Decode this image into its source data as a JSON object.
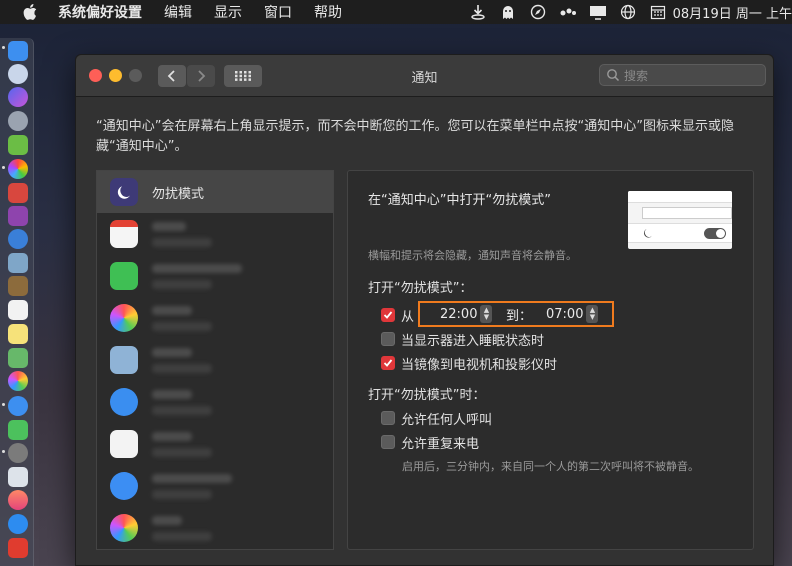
{
  "menubar": {
    "app_name": "系统偏好设置",
    "items": [
      "编辑",
      "显示",
      "窗口",
      "帮助"
    ],
    "clock": "08月19日 周一 上午"
  },
  "window": {
    "title": "通知",
    "search_placeholder": "搜索"
  },
  "intro": "“通知中心”会在屏幕右上角显示提示，而不会中断您的工作。您可以在菜单栏中点按“通知中心”图标来显示或隐藏“通知中心”。",
  "applist": {
    "selected_label": "勿扰模式"
  },
  "panel": {
    "heading": "在“通知中心”中打开“勿扰模式”",
    "subtext": "横幅和提示将会隐藏，通知声音将会静音。",
    "section1": "打开“勿扰模式”：",
    "from_label": "从",
    "from_time": "22:00",
    "to_label": "到：",
    "to_time": "07:00",
    "opt_sleep": "当显示器进入睡眠状态时",
    "opt_mirror": "当镜像到电视机和投影仪时",
    "section2": "打开“勿扰模式”时：",
    "opt_allow_calls": "允许任何人呼叫",
    "opt_repeat_calls": "允许重复来电",
    "note": "启用后，三分钟内，来自同一个人的第二次呼叫将不被静音。"
  },
  "state": {
    "from_checked": true,
    "sleep_checked": false,
    "mirror_checked": true,
    "allow_calls_checked": false,
    "repeat_calls_checked": false
  },
  "colors": {
    "accent_checkbox": "#e0373a",
    "highlight_box": "#f07b1e"
  }
}
